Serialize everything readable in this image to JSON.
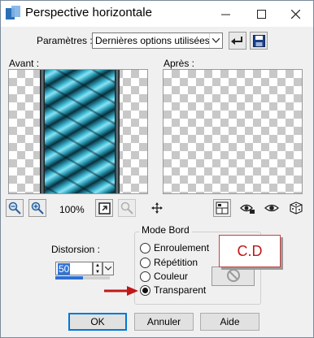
{
  "window": {
    "title": "Perspective horizontale",
    "controls": [
      "minimize-icon",
      "maximize-icon",
      "close-icon"
    ]
  },
  "presets": {
    "label": "Paramètres :",
    "selected": "Dernières options utilisées",
    "icons": [
      "undo-arrow-icon",
      "save-disk-icon"
    ]
  },
  "previews": {
    "before_label": "Avant :",
    "after_label": "Après :"
  },
  "toolbar": {
    "zoom_level": "100%",
    "icons": [
      "zoom-out-icon",
      "zoom-in-icon",
      "zoom-fit-icon",
      "zoom-disabled-icon",
      "pan-move-icon",
      "split-view-icon",
      "eye-lock-icon",
      "eye-icon",
      "random-dice-icon"
    ]
  },
  "distortion": {
    "label": "Distorsion :",
    "value": "50",
    "fill_percent": 50
  },
  "edge_mode": {
    "title": "Mode Bord",
    "options": [
      "Enroulement",
      "Répétition",
      "Couleur",
      "Transparent"
    ],
    "selected": "Transparent"
  },
  "annotation": {
    "text": "C.D",
    "arrow_color": "#c01818"
  },
  "buttons": {
    "ok": "OK",
    "cancel": "Annuler",
    "help": "Aide"
  },
  "colors": {
    "accent": "#0078d7",
    "preview_teal": "#46c2dd",
    "annotation_red": "#c01818"
  }
}
